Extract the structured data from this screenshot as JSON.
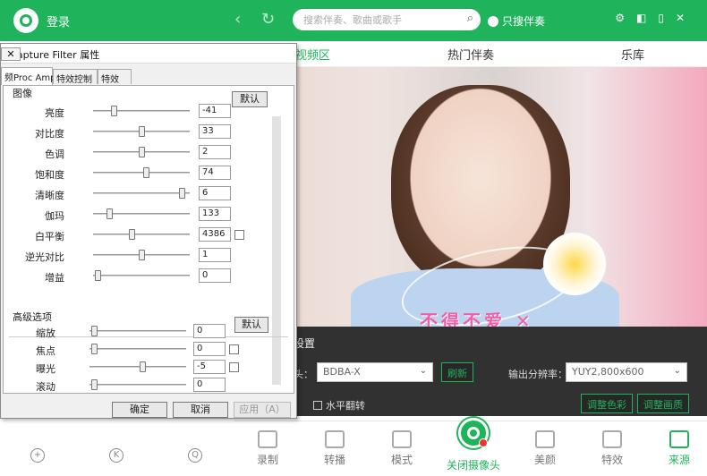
{
  "app": {
    "login_label": "登录",
    "search_placeholder": "搜索伴奏、歌曲或歌手",
    "only_search_label": "只搜伴奏",
    "tabs": [
      "视频区",
      "热门伴奏",
      "乐库"
    ],
    "camera_settings_title": "设置",
    "camera_label": "头：",
    "camera_value": "BDBA-X",
    "refresh_label": "刷新",
    "resolution_label": "输出分辨率：",
    "resolution_value": "YUY2,800x600",
    "mirror_label": "水平翻转",
    "adjust_color_label": "调整色彩",
    "adjust_image_label": "调整画质",
    "video_caption": "不得不爱",
    "bottom_nav": [
      "录制",
      "转播",
      "模式",
      "关闭摄像头",
      "美颜",
      "特效",
      "来源"
    ],
    "left_bottom_icons": [
      "+",
      "K",
      "Q"
    ],
    "accent_color": "#1fb35c"
  },
  "dialog": {
    "title": "o Capture Filter 属性",
    "close_label": "✕",
    "tabs": [
      "频Proc Amp",
      "特效控制",
      "特效"
    ],
    "image_group": "图像",
    "default_label": "默认",
    "image_rows": [
      {
        "label": "亮度",
        "value": "-41",
        "pos": 0.2
      },
      {
        "label": "对比度",
        "value": "33",
        "pos": 0.5
      },
      {
        "label": "色调",
        "value": "2",
        "pos": 0.5
      },
      {
        "label": "饱和度",
        "value": "74",
        "pos": 0.55
      },
      {
        "label": "清晰度",
        "value": "6",
        "pos": 0.95
      },
      {
        "label": "伽玛",
        "value": "133",
        "pos": 0.15
      },
      {
        "label": "白平衡",
        "value": "4386",
        "pos": 0.4
      },
      {
        "label": "逆光对比",
        "value": "1",
        "pos": 0.5
      },
      {
        "label": "增益",
        "value": "0",
        "pos": 0.02
      }
    ],
    "advanced_group": "高级选项",
    "advanced_rows": [
      {
        "label": "缩放",
        "value": "0",
        "pos": 0.02
      },
      {
        "label": "焦点",
        "value": "0",
        "pos": 0.02
      },
      {
        "label": "曝光",
        "value": "-5",
        "pos": 0.55
      },
      {
        "label": "滚动",
        "value": "0",
        "pos": 0.02
      }
    ],
    "ok_label": "确定",
    "cancel_label": "取消",
    "apply_label": "应用（A）"
  }
}
